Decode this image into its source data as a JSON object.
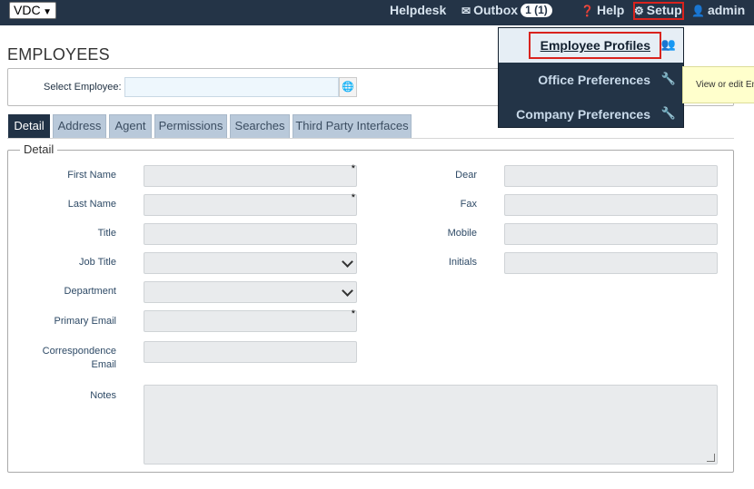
{
  "topbar": {
    "company_select": "VDC",
    "helpdesk": "Helpdesk",
    "outbox": "Outbox",
    "outbox_badge": "1 (1)",
    "help": "Help",
    "setup": "Setup",
    "user": "admin",
    "icons": {
      "outbox": "envelope-icon",
      "help": "question-circle-icon",
      "setup": "gears-icon",
      "user": "user-icon"
    }
  },
  "page": {
    "title": "EMPLOYEES"
  },
  "select_employee": {
    "label": "Select Employee:",
    "value": "",
    "icon": "globe-icon"
  },
  "tabs": [
    "Detail",
    "Address",
    "Agent",
    "Permissions",
    "Searches",
    "Third Party Interfaces"
  ],
  "active_tab": "Detail",
  "detail": {
    "legend": "Detail",
    "fields": {
      "first_name": "First Name",
      "last_name": "Last Name",
      "title": "Title",
      "job_title": "Job Title",
      "department": "Department",
      "primary_email": "Primary Email",
      "correspondence_email_1": "Correspondence",
      "correspondence_email_2": "Email",
      "notes": "Notes",
      "dear": "Dear",
      "fax": "Fax",
      "mobile": "Mobile",
      "initials": "Initials"
    },
    "required_mark": "*"
  },
  "setup_menu": {
    "items": [
      {
        "label": "Employee Profiles",
        "icon": "users-icon"
      },
      {
        "label": "Office Preferences",
        "icon": "wrench-icon"
      },
      {
        "label": "Company Preferences",
        "icon": "wrench-icon"
      }
    ]
  },
  "tooltip": {
    "text": "View or edit Em"
  },
  "colors": {
    "nav_bg": "#243447",
    "tab_active": "#213246",
    "tab_inactive": "#b9c9da",
    "highlight": "#d9231d"
  }
}
